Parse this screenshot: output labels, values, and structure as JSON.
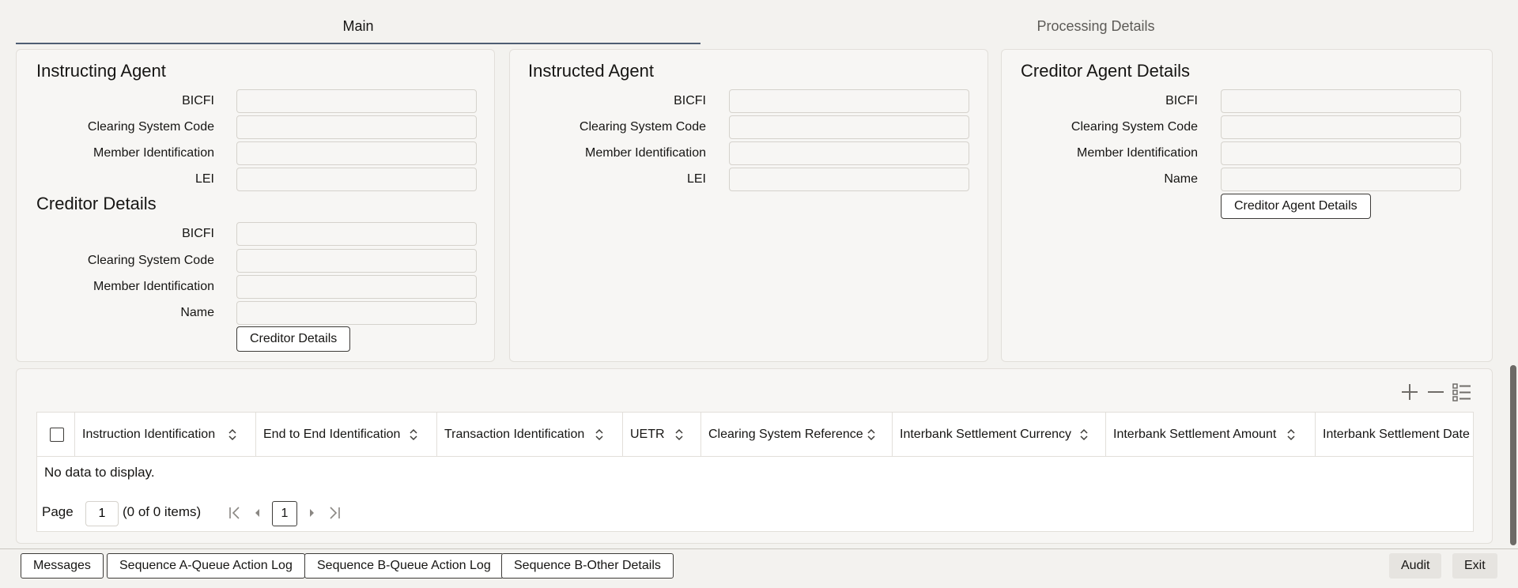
{
  "tabs": [
    {
      "label": "Main"
    },
    {
      "label": "Processing Details"
    }
  ],
  "instructing_agent": {
    "title": "Instructing Agent",
    "fields": [
      {
        "label": "BICFI",
        "value": ""
      },
      {
        "label": "Clearing System Code",
        "value": ""
      },
      {
        "label": "Member Identification",
        "value": ""
      },
      {
        "label": "LEI",
        "value": ""
      }
    ]
  },
  "creditor_details": {
    "title": "Creditor Details",
    "fields": [
      {
        "label": "BICFI",
        "value": ""
      },
      {
        "label": "Clearing System Code",
        "value": ""
      },
      {
        "label": "Member Identification",
        "value": ""
      },
      {
        "label": "Name",
        "value": ""
      }
    ],
    "button": "Creditor Details"
  },
  "instructed_agent": {
    "title": "Instructed Agent",
    "fields": [
      {
        "label": "BICFI",
        "value": ""
      },
      {
        "label": "Clearing System Code",
        "value": ""
      },
      {
        "label": "Member Identification",
        "value": ""
      },
      {
        "label": "LEI",
        "value": ""
      }
    ]
  },
  "creditor_agent": {
    "title": "Creditor Agent Details",
    "fields": [
      {
        "label": "BICFI",
        "value": ""
      },
      {
        "label": "Clearing System Code",
        "value": ""
      },
      {
        "label": "Member Identification",
        "value": ""
      },
      {
        "label": "Name",
        "value": ""
      }
    ],
    "button": "Creditor Agent Details"
  },
  "grid": {
    "columns": [
      "Instruction Identification",
      "End to End Identification",
      "Transaction Identification",
      "UETR",
      "Clearing System Reference",
      "Interbank Settlement Currency",
      "Interbank Settlement Amount",
      "Interbank Settlement Date"
    ],
    "empty_message": "No data to display.",
    "pager": {
      "page_label": "Page",
      "page_value": "1",
      "items_text": "(0 of 0 items)",
      "current_page": "1"
    }
  },
  "footer": {
    "left_buttons": [
      "Messages",
      "Sequence A-Queue Action Log",
      "Sequence B-Queue Action Log",
      "Sequence B-Other Details"
    ],
    "right_buttons": [
      "Audit",
      "Exit"
    ]
  }
}
